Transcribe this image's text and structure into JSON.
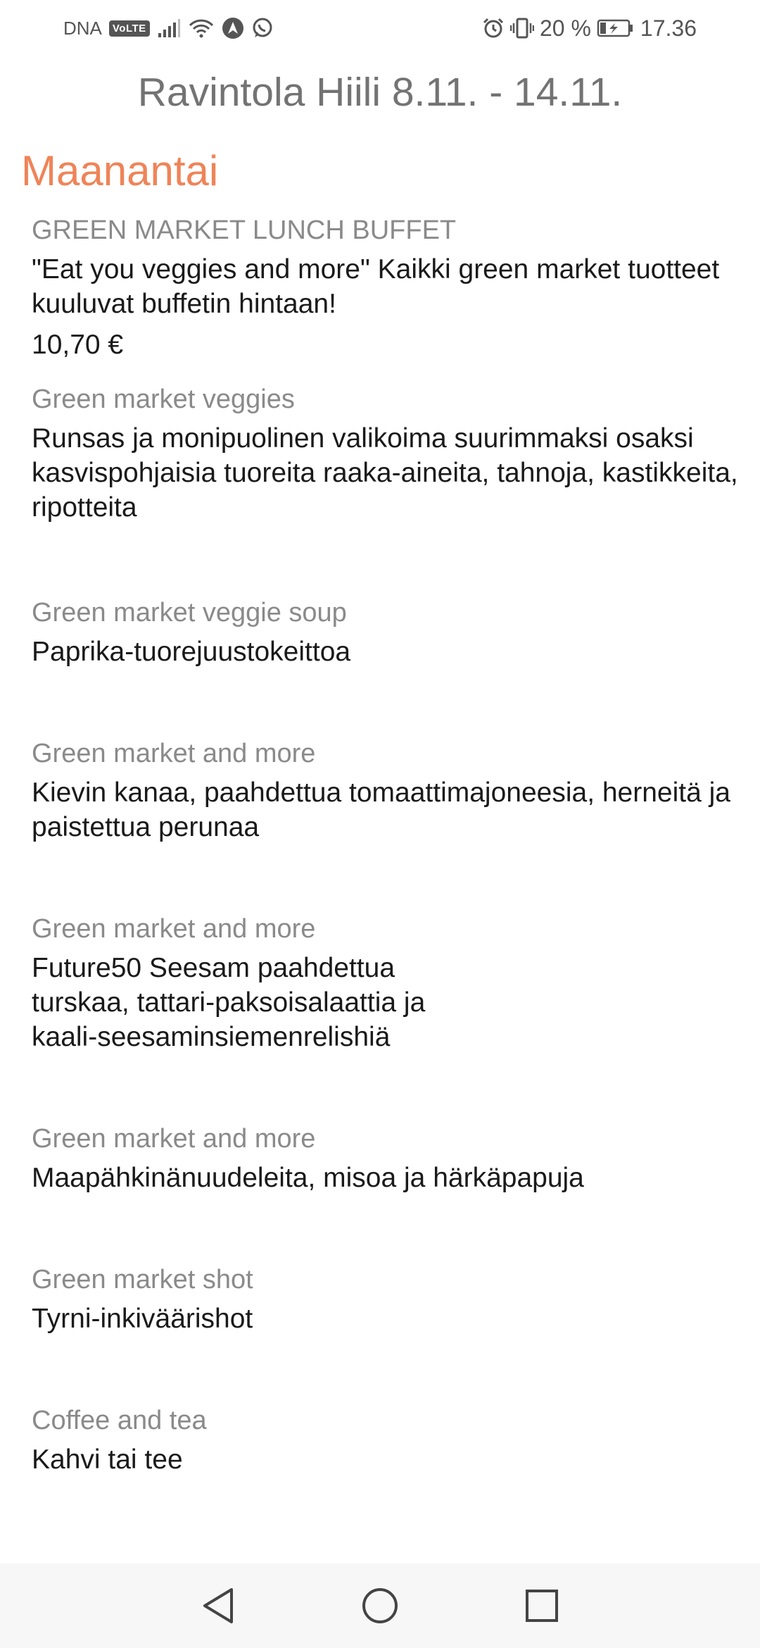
{
  "status_bar": {
    "carrier": "DNA",
    "volte": "VoLTE",
    "battery": "20 %",
    "time": "17.36",
    "icons": [
      "signal-icon",
      "wifi-icon",
      "navigation-icon",
      "whatsapp-icon",
      "alarm-icon",
      "vibrate-icon",
      "battery-charging-icon"
    ]
  },
  "header": {
    "title": "Ravintola Hiili 8.11. - 14.11."
  },
  "day": {
    "name": "Maanantai"
  },
  "items": [
    {
      "category": "GREEN MARKET LUNCH BUFFET",
      "description": "\"Eat you veggies and more\" Kaikki green market tuotteet kuuluvat buffetin hintaan!",
      "price": "10,70 €"
    },
    {
      "category": "Green market veggies",
      "description": "Runsas ja monipuolinen valikoima suurimmaksi osaksi kasvispohjaisia tuoreita raaka-aineita, tahnoja, kastikkeita, ripotteita"
    },
    {
      "category": "Green market veggie soup",
      "description": "Paprika-tuorejuustokeittoa"
    },
    {
      "category": "Green market and more",
      "description": "Kievin kanaa, paahdettua tomaattimajoneesia, herneitä ja paistettua perunaa"
    },
    {
      "category": "Green market and more",
      "description_lines": [
        "Future50 Seesam paahdettua",
        "turskaa, tattari-paksoisalaattia ja",
        "kaali-seesaminsiemenrelishiä"
      ]
    },
    {
      "category": "Green market and more",
      "description": "Maapähkinänuudeleita, misoa ja härkäpapuja"
    },
    {
      "category": "Green market shot",
      "description": "Tyrni-inkiväärishot"
    },
    {
      "category": "Coffee and tea",
      "description": "Kahvi tai tee"
    }
  ],
  "nav_bar": {
    "back": "back-icon",
    "home": "home-icon",
    "recents": "recents-icon"
  }
}
